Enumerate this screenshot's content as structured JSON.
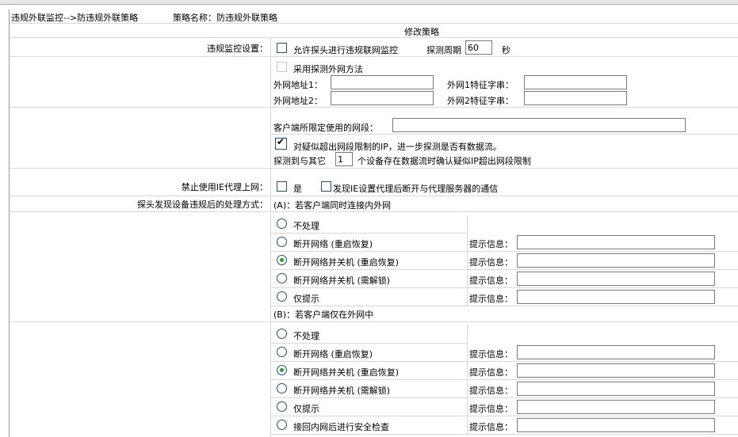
{
  "header": {
    "breadcrumb": "违规外联监控-->防违规外联策略",
    "policy_name_label": "策略名称：防违规外联策略"
  },
  "section_title": "修改策略",
  "monitor": {
    "label": "违规监控设置：",
    "allow_probe_label": "允许探头进行违规联网监控",
    "period_label": "探测周期",
    "period_value": "60",
    "period_unit": "秒"
  },
  "probe_method": {
    "label": "采用探测外网方法",
    "addr1_label": "外网地址1：",
    "addr1_value": "",
    "sig1_label": "外网1特征字串：",
    "sig1_value": "",
    "addr2_label": "外网地址2：",
    "addr2_value": "",
    "sig2_label": "外网2特征字串：",
    "sig2_value": ""
  },
  "segment": {
    "label": "客户端所限定使用的网段：",
    "value": "",
    "detect_label": "对疑似超出网段限制的IP，进一步探测是否有数据流。",
    "detect_checked": true,
    "confirm_prefix": "探测到与其它",
    "confirm_count": "1",
    "confirm_suffix": "个设备存在数据流时确认疑似IP超出网段限制"
  },
  "ie_proxy": {
    "label": "禁止使用IE代理上网：",
    "yes_label": "是",
    "disconnect_label": "发现IE设置代理后断开与代理服务器的通信"
  },
  "handling": {
    "label": "探头发现设备违规后的处理方式：",
    "case_a": "(A)：若客户端同时连接内外网",
    "case_b": "(B)：若客户端仅在外网中",
    "hint_label": "提示信息：",
    "options_a": [
      {
        "label": "不处理",
        "selected": false,
        "hint": false
      },
      {
        "label": "断开网络 (重启恢复)",
        "selected": false,
        "hint": true
      },
      {
        "label": "断开网络并关机 (重启恢复)",
        "selected": true,
        "hint": true
      },
      {
        "label": "断开网络并关机 (需解锁)",
        "selected": false,
        "hint": true
      },
      {
        "label": "仅提示",
        "selected": false,
        "hint": true
      }
    ],
    "options_b": [
      {
        "label": "不处理",
        "selected": false,
        "hint": false
      },
      {
        "label": "断开网络 (重启恢复)",
        "selected": false,
        "hint": true
      },
      {
        "label": "断开网络并关机 (重启恢复)",
        "selected": true,
        "hint": true
      },
      {
        "label": "断开网络并关机 (需解锁)",
        "selected": false,
        "hint": true
      },
      {
        "label": "仅提示",
        "selected": false,
        "hint": true
      },
      {
        "label": "接回内网后进行安全检查",
        "selected": false,
        "hint": true
      }
    ]
  }
}
